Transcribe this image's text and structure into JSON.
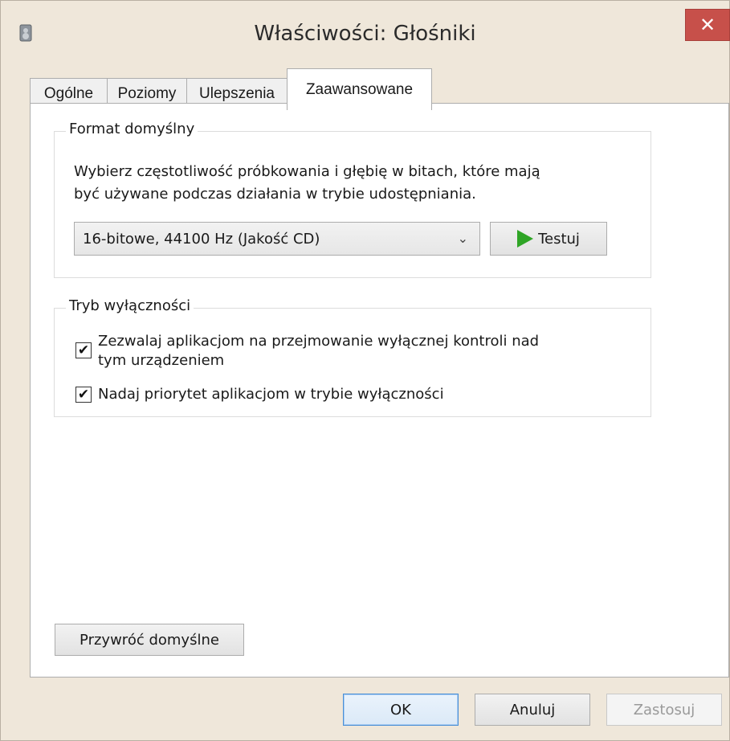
{
  "window": {
    "title": "Właściwości: Głośniki",
    "close_glyph": "✕"
  },
  "tabs": [
    {
      "label": "Ogólne"
    },
    {
      "label": "Poziomy"
    },
    {
      "label": "Ulepszenia"
    },
    {
      "label": "Zaawansowane",
      "active": true
    }
  ],
  "default_format": {
    "legend": "Format domyślny",
    "description_line1": "Wybierz częstotliwość próbkowania i głębię w bitach, które mają",
    "description_line2": "być używane podczas działania w trybie udostępniania.",
    "selected_value": "16-bitowe, 44100 Hz (Jakość CD)",
    "chevron_glyph": "⌄",
    "test_label": "Testuj"
  },
  "exclusive_mode": {
    "legend": "Tryb wyłączności",
    "options": [
      {
        "label_line1": "Zezwalaj aplikacjom na przejmowanie wyłącznej kontroli nad",
        "label_line2": "tym urządzeniem",
        "checked": true,
        "check_glyph": "✔"
      },
      {
        "label_line1": "Nadaj priorytet aplikacjom w trybie wyłączności",
        "checked": true,
        "check_glyph": "✔"
      }
    ]
  },
  "restore_defaults_label": "Przywróć domyślne",
  "footer": {
    "ok_label": "OK",
    "cancel_label": "Anuluj",
    "apply_label": "Zastosuj"
  },
  "colors": {
    "dialog_bg": "#efe7da",
    "close_button": "#c7504a",
    "play_icon": "#2fa526"
  }
}
